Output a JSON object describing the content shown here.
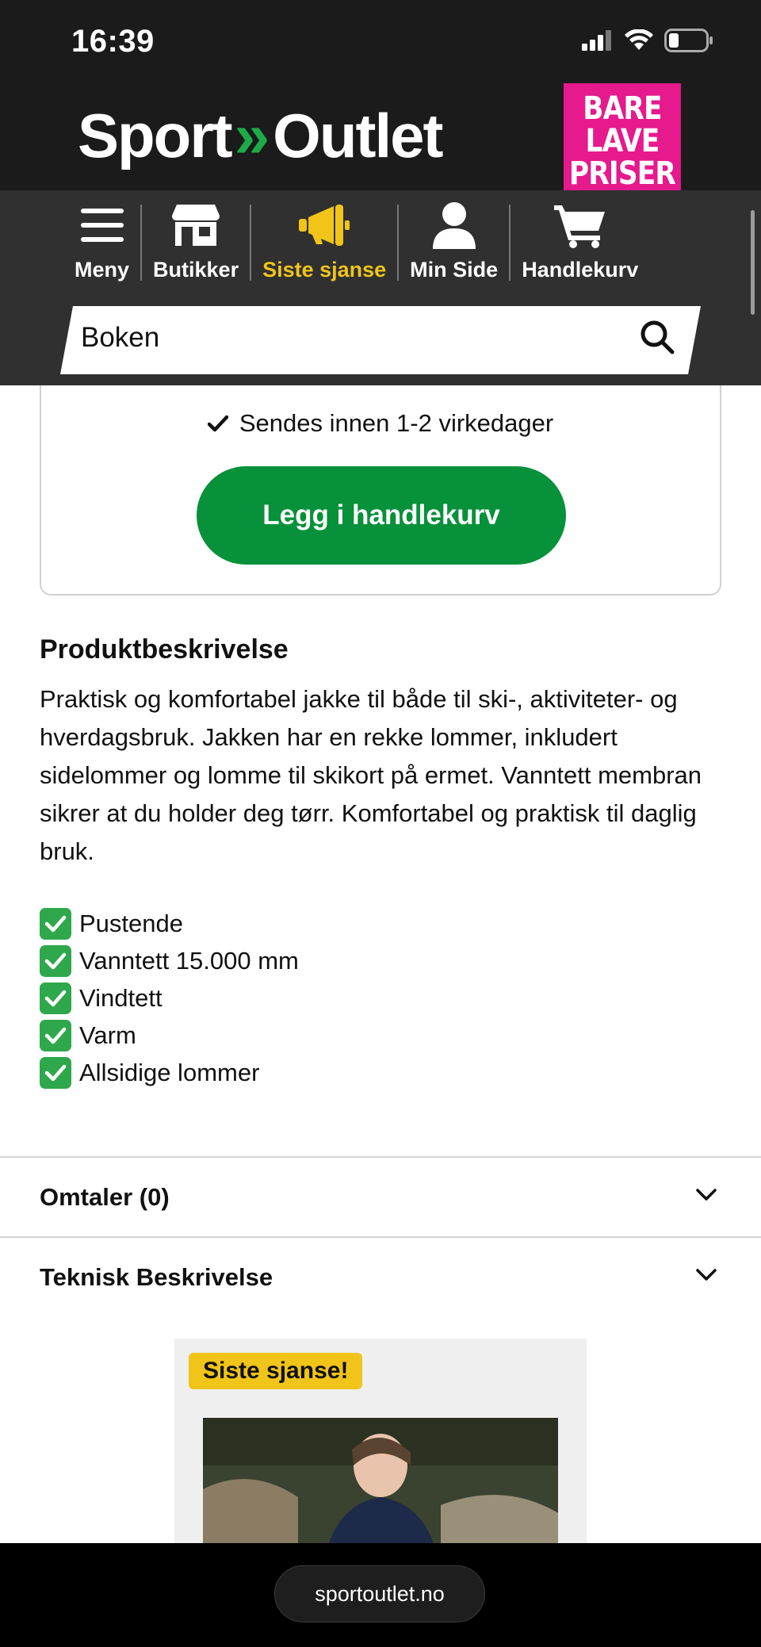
{
  "status": {
    "time": "16:39"
  },
  "header": {
    "logo_left": "Sport",
    "logo_arrows": "»",
    "logo_right": "Outlet",
    "promo_lines": [
      "BARE",
      "LAVE",
      "PRISER"
    ]
  },
  "nav": {
    "items": [
      {
        "label": "Meny",
        "icon": "menu-icon"
      },
      {
        "label": "Butikker",
        "icon": "store-icon"
      },
      {
        "label": "Siste sjanse",
        "icon": "megaphone-icon",
        "active": true
      },
      {
        "label": "Min Side",
        "icon": "user-icon"
      },
      {
        "label": "Handlekurv",
        "icon": "cart-icon"
      }
    ],
    "active_color": "#f0c419"
  },
  "search": {
    "value": "Boken"
  },
  "buy_box": {
    "shipping": "Sendes innen 1-2 virkedager",
    "add_to_cart": "Legg i handlekurv",
    "button_color": "#07913a"
  },
  "description": {
    "title": "Produktbeskrivelse",
    "text": "Praktisk og komfortabel jakke til både til ski-, aktiviteter- og hverdagsbruk. Jakken har en rekke lommer, inkludert sidelommer og lomme til skikort på ermet. Vanntett membran sikrer at du holder deg tørr. Komfortabel og praktisk til daglig bruk.",
    "features": [
      "Pustende",
      "Vanntett 15.000 mm",
      "Vindtett",
      "Varm",
      "Allsidige lommer"
    ]
  },
  "accordions": {
    "reviews": "Omtaler (0)",
    "technical": "Teknisk Beskrivelse"
  },
  "card": {
    "badge": "Siste sjanse!"
  },
  "browser": {
    "url": "sportoutlet.no"
  }
}
